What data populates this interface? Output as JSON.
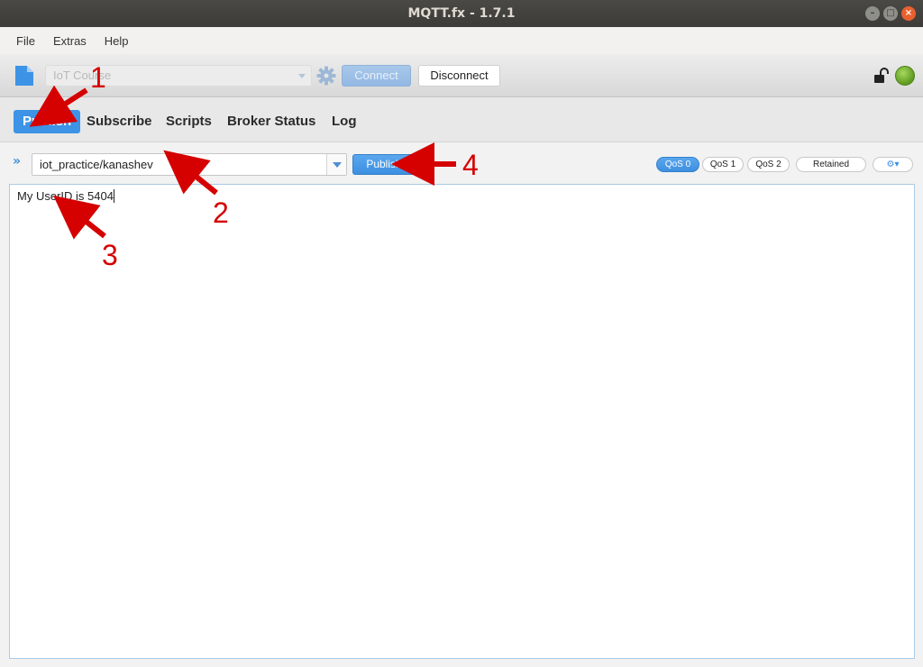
{
  "window": {
    "title": "MQTT.fx - 1.7.1"
  },
  "menu": {
    "items": [
      "File",
      "Extras",
      "Help"
    ]
  },
  "toolbar": {
    "profile": "IoT Course",
    "connect_label": "Connect",
    "disconnect_label": "Disconnect",
    "connection_status": "connected",
    "status_color": "#6aab2b"
  },
  "tabs": [
    "Publish",
    "Subscribe",
    "Scripts",
    "Broker Status",
    "Log"
  ],
  "publish": {
    "topic": "iot_practice/kanashev",
    "publish_label": "Publish",
    "qos": [
      "QoS 0",
      "QoS 1",
      "QoS 2"
    ],
    "selected_qos": "QoS 0",
    "retained_label": "Retained",
    "message": "My UserID is 5404"
  },
  "annotations": [
    "1",
    "2",
    "3",
    "4"
  ],
  "colors": {
    "accent": "#3d93e6",
    "annotation": "#d50000"
  }
}
